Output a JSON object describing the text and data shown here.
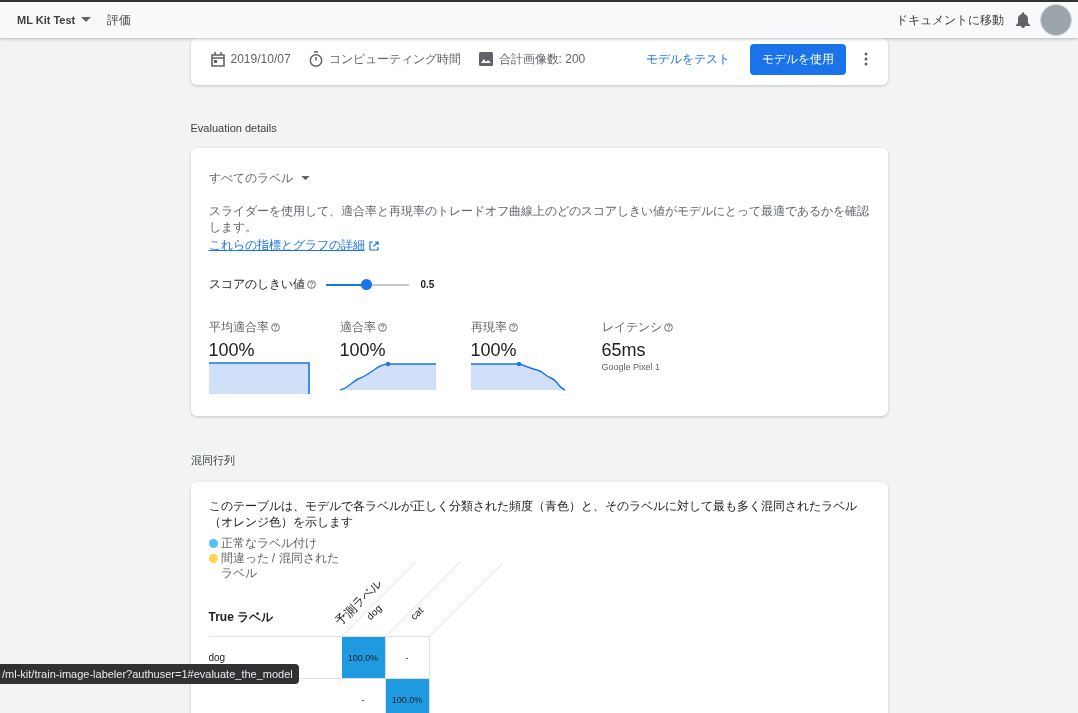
{
  "header": {
    "project": "ML Kit Test",
    "page": "評価",
    "docs_link": "ドキュメントに移動"
  },
  "model_card": {
    "date": "2019/10/07",
    "compute_time": "コンピューティング時間",
    "image_count": "合計画像数: 200",
    "test_button": "モデルをテスト",
    "use_button": "モデルを使用"
  },
  "evaluation": {
    "heading": "Evaluation details",
    "label_filter": "すべてのラベル",
    "description": "スライダーを使用して、適合率と再現率のトレードオフ曲線上のどのスコアしきい値がモデルにとって最適であるかを確認します。",
    "details_link": "これらの指標とグラフの詳細",
    "threshold_label": "スコアのしきい値",
    "threshold": {
      "level": 0.5
    },
    "threshold_value": "0.5",
    "metrics": [
      {
        "kind": "flat",
        "label": "平均適合率",
        "value": "100%"
      },
      {
        "kind": "rising",
        "label": "適合率",
        "value": "100%"
      },
      {
        "kind": "falling",
        "label": "再現率",
        "value": "100%"
      },
      {
        "kind": "text",
        "label": "レイテンシ",
        "value": "65ms",
        "note": "Google Pixel 1"
      }
    ]
  },
  "confusion": {
    "heading": "混同行列",
    "description": "このテーブルは、モデルで各ラベルが正しく分類された頻度（青色）と、そのラベルに対して最も多く混同されたラベル（オレンジ色）を示します",
    "legend": [
      {
        "label": "正常なラベル付け",
        "color": "#4fc3f7"
      },
      {
        "label": "間違った / 混同されたラベル",
        "color": "#ffd54f"
      }
    ],
    "row_header": "True ラベル",
    "column_header": "予測ラベル",
    "columns": [
      "dog",
      "cat"
    ],
    "rows": [
      {
        "label": "dog",
        "cells": [
          {
            "kind": "correct",
            "value": "100.0%"
          },
          {
            "kind": "none",
            "value": "-"
          }
        ]
      },
      {
        "cells": [
          {
            "kind": "none",
            "value": "-"
          },
          {
            "kind": "correct",
            "value": "100.0%"
          }
        ]
      }
    ]
  },
  "status_url": "/ml-kit/train-image-labeler?authuser=1#evaluate_the_model"
}
